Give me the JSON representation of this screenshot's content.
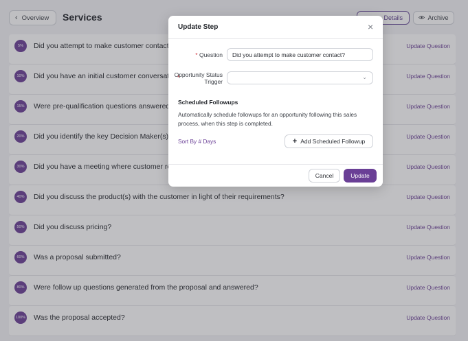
{
  "header": {
    "back_label": "Overview",
    "back_icon": "chevron-left-icon",
    "title": "Services",
    "details_label": "Details",
    "archive_label": "Archive",
    "archive_icon": "eye-icon"
  },
  "steps": [
    {
      "pct": "5%",
      "question": "Did you attempt to make customer contact?",
      "action": "Update Question"
    },
    {
      "pct": "10%",
      "question": "Did you have an initial customer conversation?",
      "action": "Update Question"
    },
    {
      "pct": "15%",
      "question": "Were pre-qualification questions answered?",
      "action": "Update Question"
    },
    {
      "pct": "20%",
      "question": "Did you identify the key Decision Maker(s)?",
      "action": "Update Question"
    },
    {
      "pct": "30%",
      "question": "Did you have a meeting where customer requirements were reviewed?",
      "action": "Update Question"
    },
    {
      "pct": "40%",
      "question": "Did you discuss the product(s) with the customer in light of their requirements?",
      "action": "Update Question"
    },
    {
      "pct": "50%",
      "question": "Did you discuss pricing?",
      "action": "Update Question"
    },
    {
      "pct": "60%",
      "question": "Was a proposal submitted?",
      "action": "Update Question"
    },
    {
      "pct": "80%",
      "question": "Were follow up questions generated from the proposal and answered?",
      "action": "Update Question"
    },
    {
      "pct": "100%",
      "question": "Was the proposal accepted?",
      "action": "Update Question"
    }
  ],
  "modal": {
    "title": "Update Step",
    "close_icon": "close-icon",
    "question_label": "Question",
    "question_value": "Did you attempt to make customer contact?",
    "opportunity_label": "Opportunity Status Trigger",
    "opportunity_value": "",
    "scheduled_title": "Scheduled Followups",
    "scheduled_desc": "Automatically schedule followups for an opportunity following this sales process, when this step is completed.",
    "sort_label": "Sort By # Days",
    "add_followup_label": "Add Scheduled Followup",
    "cancel_label": "Cancel",
    "update_label": "Update"
  },
  "colors": {
    "accent": "#6a3f96",
    "required": "#d2363f"
  }
}
